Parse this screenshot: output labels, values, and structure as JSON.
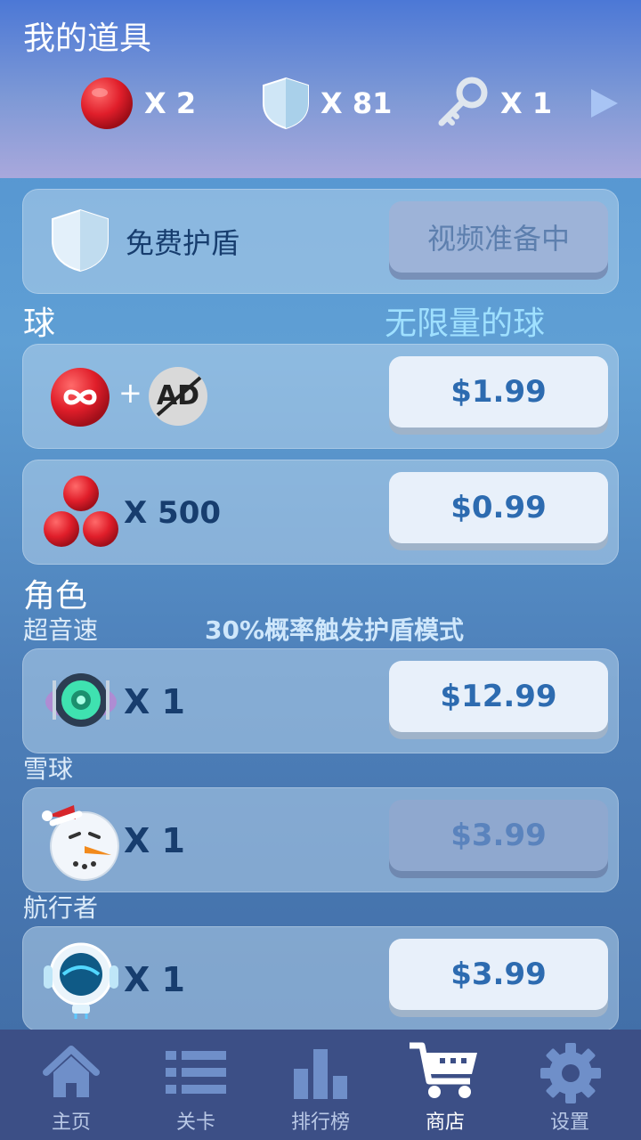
{
  "header": {
    "title": "我的道具",
    "inventory": [
      {
        "icon": "red-ball-icon",
        "count": "X 2"
      },
      {
        "icon": "shield-icon",
        "count": "X 81"
      },
      {
        "icon": "key-icon",
        "count": "X 1"
      }
    ]
  },
  "free_shield": {
    "label": "免费护盾",
    "button": "视频准备中"
  },
  "balls": {
    "section": "球",
    "highlight": "无限量的球",
    "unlimited": {
      "ad_text": "AD",
      "price": "$1.99"
    },
    "pack": {
      "qty": "X 500",
      "price": "$0.99"
    }
  },
  "characters": {
    "section": "角色",
    "items": [
      {
        "name": "超音速",
        "desc": "30%概率触发护盾模式",
        "qty": "X 1",
        "price": "$12.99",
        "state": "enabled"
      },
      {
        "name": "雪球",
        "qty": "X 1",
        "price": "$3.99",
        "state": "disabled"
      },
      {
        "name": "航行者",
        "qty": "X 1",
        "price": "$3.99",
        "state": "enabled"
      }
    ]
  },
  "nav": {
    "items": [
      {
        "label": "主页",
        "icon": "home-icon",
        "active": false
      },
      {
        "label": "关卡",
        "icon": "list-icon",
        "active": false
      },
      {
        "label": "排行榜",
        "icon": "leaderboard-icon",
        "active": false
      },
      {
        "label": "商店",
        "icon": "cart-icon",
        "active": true
      },
      {
        "label": "设置",
        "icon": "gear-icon",
        "active": false
      }
    ]
  },
  "colors": {
    "accent": "#2d6bb0",
    "highlight": "#9fe0ff",
    "nav_bg": "#3c4f86"
  }
}
